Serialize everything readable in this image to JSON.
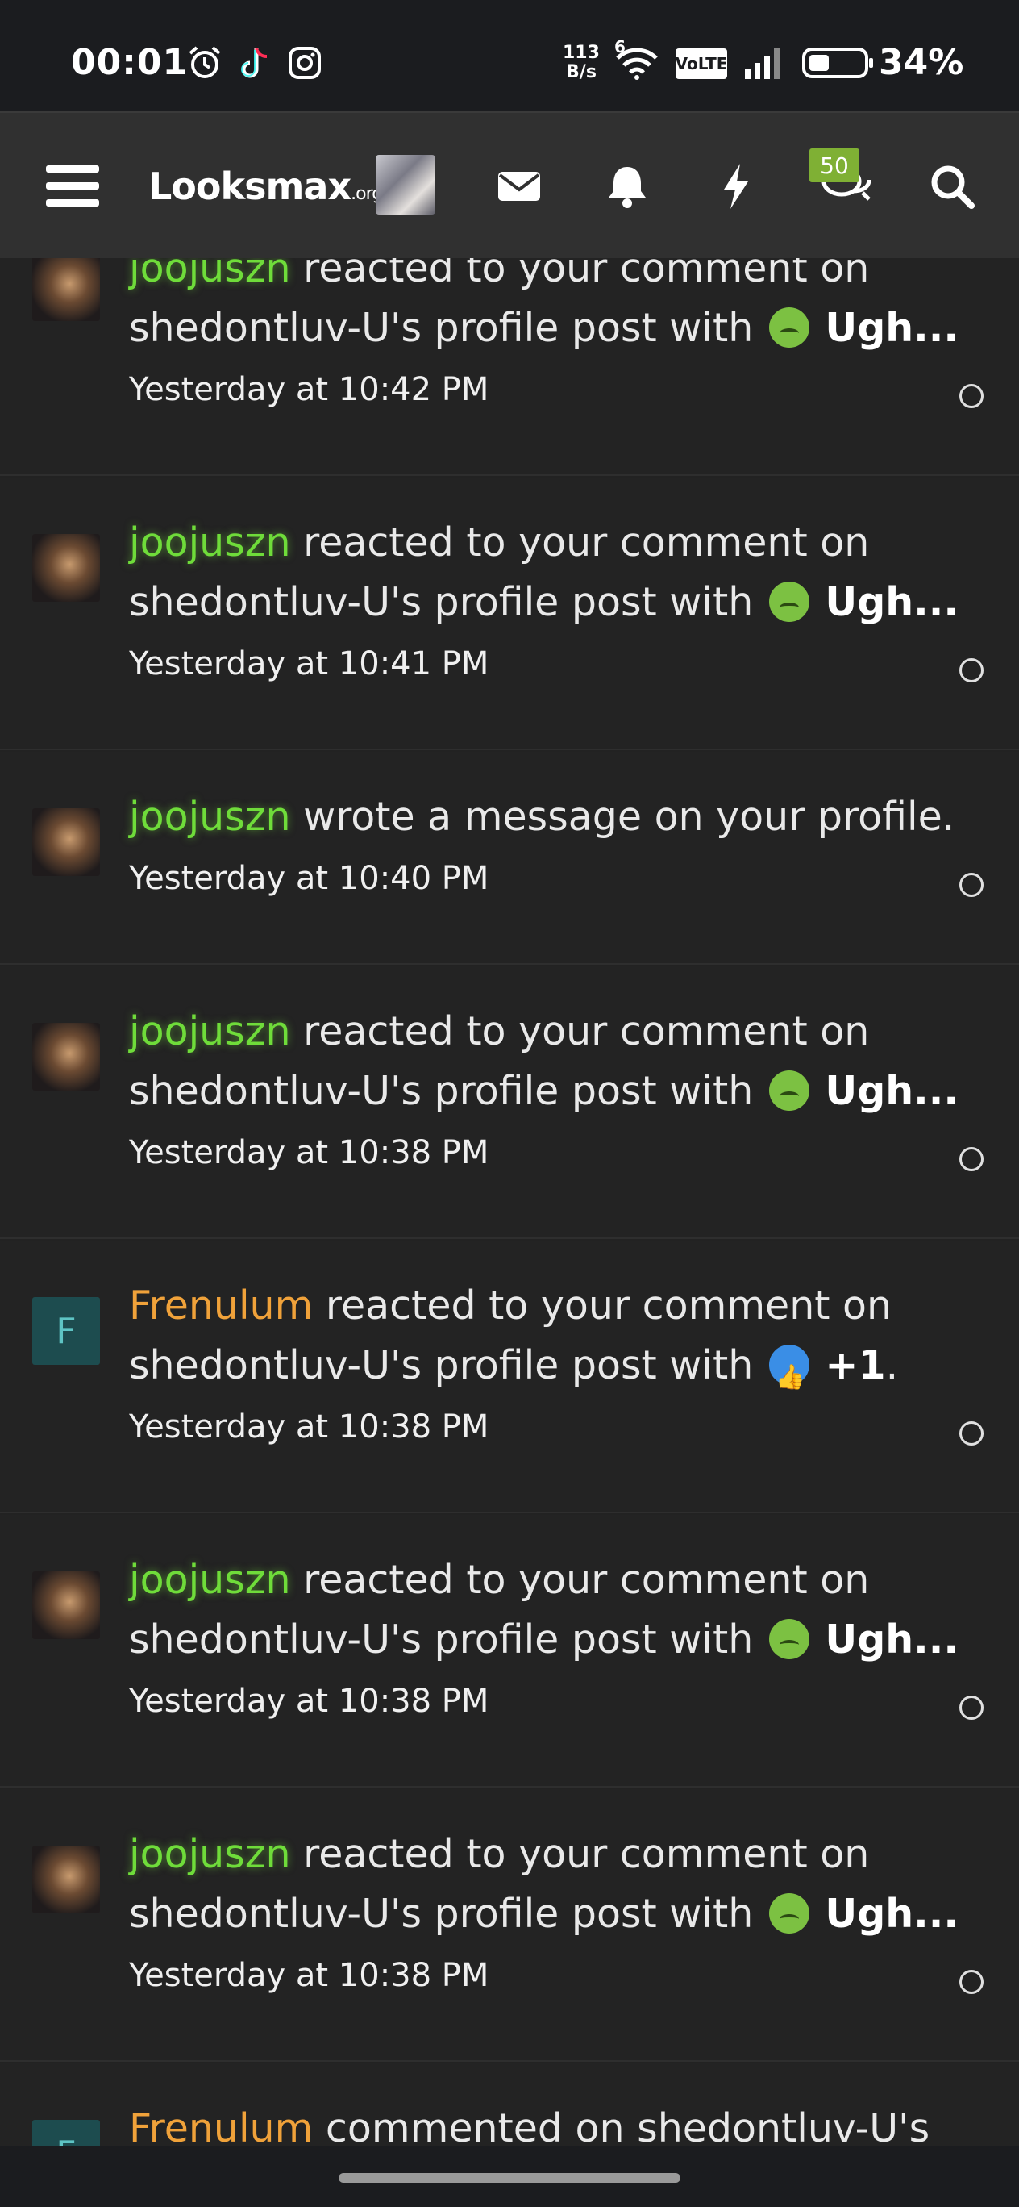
{
  "status_bar": {
    "time": "00:01",
    "net_speed_value": "113",
    "net_speed_unit": "B/s",
    "volte": "VoLTE",
    "wifi_sub": "6",
    "battery": "34%",
    "icons": [
      "alarm-icon",
      "tiktok-icon",
      "instagram-icon",
      "wifi-icon",
      "signal-icon",
      "battery-icon"
    ]
  },
  "nav": {
    "logo_main": "Looksmax",
    "logo_suffix": ".org",
    "conversations_badge": "50",
    "icons": [
      "menu-icon",
      "envelope-icon",
      "bell-icon",
      "bolt-icon",
      "comments-icon",
      "search-icon"
    ]
  },
  "notifications": [
    {
      "user": "joojuszn",
      "user_color": "green",
      "text_1": " reacted to your comment on shedontluv-U's profile post with ",
      "reaction": "Ugh...",
      "emoji": "ugh",
      "time": "Yesterday at 10:42 PM"
    },
    {
      "user": "joojuszn",
      "user_color": "green",
      "text_1": " reacted to your comment on shedontluv-U's profile post with ",
      "reaction": "Ugh...",
      "emoji": "ugh",
      "time": "Yesterday at 10:41 PM"
    },
    {
      "user": "joojuszn",
      "user_color": "green",
      "text_1": " wrote a message on your profile.",
      "reaction": "",
      "emoji": "",
      "time": "Yesterday at 10:40 PM"
    },
    {
      "user": "joojuszn",
      "user_color": "green",
      "text_1": " reacted to your comment on shedontluv-U's profile post with ",
      "reaction": "Ugh...",
      "emoji": "ugh",
      "time": "Yesterday at 10:38 PM"
    },
    {
      "user": "Frenulum",
      "user_color": "orange",
      "avatar_letter": "F",
      "text_1": " reacted to your comment on shedontluv-U's profile post with ",
      "reaction": "+1",
      "reaction_suffix": ".",
      "emoji": "like",
      "time": "Yesterday at 10:38 PM"
    },
    {
      "user": "joojuszn",
      "user_color": "green",
      "text_1": " reacted to your comment on shedontluv-U's profile post with ",
      "reaction": "Ugh...",
      "emoji": "ugh",
      "time": "Yesterday at 10:38 PM"
    },
    {
      "user": "joojuszn",
      "user_color": "green",
      "text_1": " reacted to your comment on shedontluv-U's profile post with ",
      "reaction": "Ugh...",
      "emoji": "ugh",
      "time": "Yesterday at 10:38 PM"
    },
    {
      "user": "Frenulum",
      "user_color": "orange",
      "avatar_letter": "F",
      "text_1": " commented on shedontluv-U's",
      "reaction": "",
      "emoji": "",
      "time": ""
    }
  ],
  "colors": {
    "background": "#222222",
    "navbar": "#303030",
    "username_green": "#6fdc3a",
    "username_orange": "#f0a23a",
    "badge": "#7fb034"
  }
}
